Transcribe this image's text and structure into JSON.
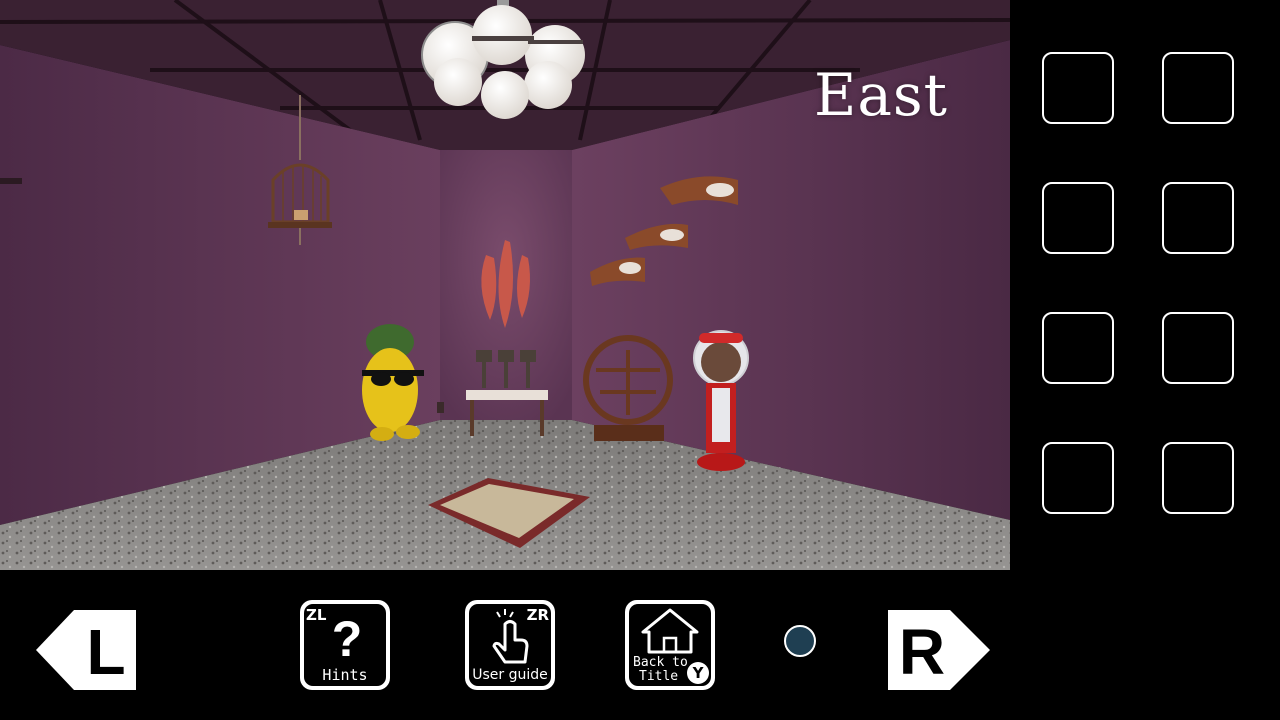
{
  "room": {
    "direction": "East"
  },
  "inventory": {
    "slot_count": 8
  },
  "nav": {
    "left_key": "L",
    "right_key": "R"
  },
  "menu": {
    "hints": {
      "corner": "ZL",
      "label": "Hints",
      "icon": "question-icon"
    },
    "user_guide": {
      "corner": "ZR",
      "label": "User guide",
      "icon": "tap-hand-icon"
    },
    "back_to_title": {
      "label_line1": "Back to",
      "label_line2": "Title",
      "corner": "Y",
      "icon": "house-icon"
    }
  },
  "colors": {
    "wall": "#5b3552",
    "ceiling": "#3c2233",
    "floor": "#8a8886",
    "page_dot": "#1f3f52"
  }
}
